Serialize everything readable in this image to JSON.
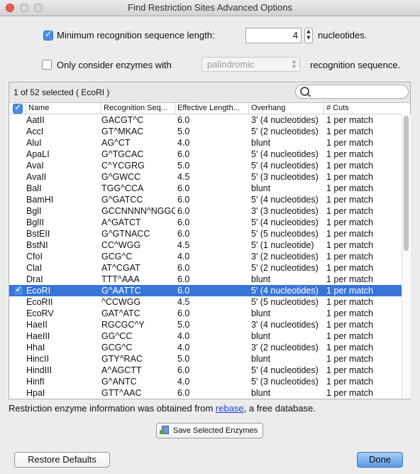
{
  "window": {
    "title": "Find Restriction Sites Advanced Options"
  },
  "options": {
    "min_length": {
      "checked": true,
      "label": "Minimum recognition sequence length:",
      "value": "4",
      "suffix": "nucleotides."
    },
    "only_consider": {
      "checked": false,
      "label": "Only consider enzymes with",
      "select_value": "palindromic",
      "suffix": "recognition sequence."
    }
  },
  "table": {
    "selection_text": "1 of 52 selected ( EcoRI )",
    "headers": [
      "Name",
      "Recognition Seq...",
      "Effective Length...",
      "Overhang",
      "# Cuts"
    ],
    "rows": [
      {
        "name": "AatII",
        "seq": "GACGT^C",
        "len": "6.0",
        "overhang": "3' (4 nucleotides)",
        "cuts": "1 per match",
        "checked": false
      },
      {
        "name": "AccI",
        "seq": "GT^MKAC",
        "len": "5.0",
        "overhang": "5' (2 nucleotides)",
        "cuts": "1 per match",
        "checked": false
      },
      {
        "name": "AluI",
        "seq": "AG^CT",
        "len": "4.0",
        "overhang": "blunt",
        "cuts": "1 per match",
        "checked": false
      },
      {
        "name": "ApaLI",
        "seq": "G^TGCAC",
        "len": "6.0",
        "overhang": "5' (4 nucleotides)",
        "cuts": "1 per match",
        "checked": false
      },
      {
        "name": "AvaI",
        "seq": "C^YCGRG",
        "len": "5.0",
        "overhang": "5' (4 nucleotides)",
        "cuts": "1 per match",
        "checked": false
      },
      {
        "name": "AvaII",
        "seq": "G^GWCC",
        "len": "4.5",
        "overhang": "5' (3 nucleotides)",
        "cuts": "1 per match",
        "checked": false
      },
      {
        "name": "BalI",
        "seq": "TGG^CCA",
        "len": "6.0",
        "overhang": "blunt",
        "cuts": "1 per match",
        "checked": false
      },
      {
        "name": "BamHI",
        "seq": "G^GATCC",
        "len": "6.0",
        "overhang": "5' (4 nucleotides)",
        "cuts": "1 per match",
        "checked": false
      },
      {
        "name": "BglI",
        "seq": "GCCNNNN^NGGC",
        "len": "6.0",
        "overhang": "3' (3 nucleotides)",
        "cuts": "1 per match",
        "checked": false
      },
      {
        "name": "BglII",
        "seq": "A^GATCT",
        "len": "6.0",
        "overhang": "5' (4 nucleotides)",
        "cuts": "1 per match",
        "checked": false
      },
      {
        "name": "BstEII",
        "seq": "G^GTNACC",
        "len": "6.0",
        "overhang": "5' (5 nucleotides)",
        "cuts": "1 per match",
        "checked": false
      },
      {
        "name": "BstNI",
        "seq": "CC^WGG",
        "len": "4.5",
        "overhang": "5' (1 nucleotide)",
        "cuts": "1 per match",
        "checked": false
      },
      {
        "name": "CfoI",
        "seq": "GCG^C",
        "len": "4.0",
        "overhang": "3' (2 nucleotides)",
        "cuts": "1 per match",
        "checked": false
      },
      {
        "name": "ClaI",
        "seq": "AT^CGAT",
        "len": "6.0",
        "overhang": "5' (2 nucleotides)",
        "cuts": "1 per match",
        "checked": false
      },
      {
        "name": "DraI",
        "seq": "TTT^AAA",
        "len": "6.0",
        "overhang": "blunt",
        "cuts": "1 per match",
        "checked": false
      },
      {
        "name": "EcoRI",
        "seq": "G^AATTC",
        "len": "6.0",
        "overhang": "5' (4 nucleotides)",
        "cuts": "1 per match",
        "checked": true
      },
      {
        "name": "EcoRII",
        "seq": "^CCWGG",
        "len": "4.5",
        "overhang": "5' (5 nucleotides)",
        "cuts": "1 per match",
        "checked": false
      },
      {
        "name": "EcoRV",
        "seq": "GAT^ATC",
        "len": "6.0",
        "overhang": "blunt",
        "cuts": "1 per match",
        "checked": false
      },
      {
        "name": "HaeII",
        "seq": "RGCGC^Y",
        "len": "5.0",
        "overhang": "3' (4 nucleotides)",
        "cuts": "1 per match",
        "checked": false
      },
      {
        "name": "HaeIII",
        "seq": "GG^CC",
        "len": "4.0",
        "overhang": "blunt",
        "cuts": "1 per match",
        "checked": false
      },
      {
        "name": "HhaI",
        "seq": "GCG^C",
        "len": "4.0",
        "overhang": "3' (2 nucleotides)",
        "cuts": "1 per match",
        "checked": false
      },
      {
        "name": "HincII",
        "seq": "GTY^RAC",
        "len": "5.0",
        "overhang": "blunt",
        "cuts": "1 per match",
        "checked": false
      },
      {
        "name": "HindIII",
        "seq": "A^AGCTT",
        "len": "6.0",
        "overhang": "5' (4 nucleotides)",
        "cuts": "1 per match",
        "checked": false
      },
      {
        "name": "HinfI",
        "seq": "G^ANTC",
        "len": "4.0",
        "overhang": "5' (3 nucleotides)",
        "cuts": "1 per match",
        "checked": false
      },
      {
        "name": "HpaI",
        "seq": "GTT^AAC",
        "len": "6.0",
        "overhang": "blunt",
        "cuts": "1 per match",
        "checked": false
      }
    ],
    "selected_index": 15
  },
  "footer": {
    "info_prefix": "Restriction enzyme information was obtained from ",
    "info_link": "rebase",
    "info_suffix": ", a free database.",
    "save_label": "Save Selected Enzymes",
    "restore_label": "Restore Defaults",
    "done_label": "Done"
  },
  "icons": {
    "search": "search-icon",
    "save": "save-enzymes-icon"
  },
  "colors": {
    "selection": "#3875d7",
    "checkbox_on": "#4a8ee8",
    "close_button": "#ee5c54",
    "link": "#1f3fd6"
  }
}
